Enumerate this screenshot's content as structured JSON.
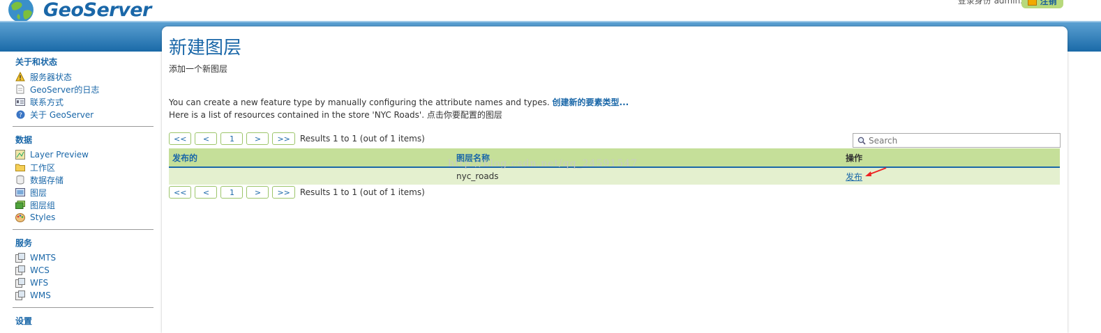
{
  "header": {
    "app_name": "GeoServer",
    "login_text": "登录身份 admin.",
    "logout_label": "注销"
  },
  "sidebar": {
    "sections": [
      {
        "title": "关于和状态",
        "items": [
          {
            "label": "服务器状态",
            "icon": "warning-icon"
          },
          {
            "label": "GeoServer的日志",
            "icon": "document-icon"
          },
          {
            "label": "联系方式",
            "icon": "contact-card-icon"
          },
          {
            "label": "关于 GeoServer",
            "icon": "info-icon"
          }
        ]
      },
      {
        "title": "数据",
        "items": [
          {
            "label": "Layer Preview",
            "icon": "map-preview-icon"
          },
          {
            "label": "工作区",
            "icon": "folder-icon"
          },
          {
            "label": "数据存储",
            "icon": "database-icon"
          },
          {
            "label": "图层",
            "icon": "layer-icon"
          },
          {
            "label": "图层组",
            "icon": "layer-group-icon"
          },
          {
            "label": "Styles",
            "icon": "palette-icon"
          }
        ]
      },
      {
        "title": "服务",
        "items": [
          {
            "label": "WMTS",
            "icon": "service-icon"
          },
          {
            "label": "WCS",
            "icon": "service-icon"
          },
          {
            "label": "WFS",
            "icon": "service-icon"
          },
          {
            "label": "WMS",
            "icon": "service-icon"
          }
        ]
      },
      {
        "title": "设置",
        "items": []
      }
    ]
  },
  "main": {
    "title": "新建图层",
    "subtitle": "添加一个新图层",
    "desc_line1": "You can create a new feature type by manually configuring the attribute names and types.",
    "desc_link": "创建新的要素类型...",
    "desc_line2": "Here is a list of resources contained in the store 'NYC Roads'. 点击你要配置的图层",
    "pager": {
      "first": "<<",
      "prev": "<",
      "page": "1",
      "next": ">",
      "last": ">>",
      "result": "Results 1 to 1 (out of 1 items)"
    },
    "search_placeholder": "Search",
    "table": {
      "columns": [
        "发布的",
        "图层名称",
        "操作"
      ],
      "rows": [
        {
          "published": "",
          "name": "nyc_roads",
          "action": "发布"
        }
      ]
    },
    "watermark": "http://blog.csdn.net/qq_24591547"
  },
  "colors": {
    "accent": "#1a67a8",
    "header_green": "#c5df99",
    "row_green": "#e4f0cf",
    "band": "#1a6aa8"
  }
}
